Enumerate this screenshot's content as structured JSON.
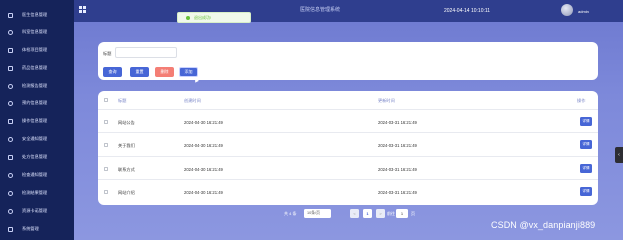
{
  "sidebar": {
    "items": [
      {
        "label": "医生信息管理",
        "icon": "document-icon"
      },
      {
        "label": "科室信息管理",
        "icon": "circle-check-icon"
      },
      {
        "label": "体检项目管理",
        "icon": "document-icon"
      },
      {
        "label": "药品信息管理",
        "icon": "document-icon"
      },
      {
        "label": "检测报告管理",
        "icon": "chat-icon"
      },
      {
        "label": "预约信息管理",
        "icon": "circle-check-icon"
      },
      {
        "label": "操作信息管理",
        "icon": "document-icon"
      },
      {
        "label": "安全通知管理",
        "icon": "circle-check-icon"
      },
      {
        "label": "处方信息管理",
        "icon": "document-icon"
      },
      {
        "label": "检查通知管理",
        "icon": "chat-icon"
      },
      {
        "label": "检测结果管理",
        "icon": "circle-check-icon"
      },
      {
        "label": "资源卡诺管理",
        "icon": "circle-check-icon"
      },
      {
        "label": "系统管理",
        "icon": "document-icon"
      }
    ]
  },
  "topbar": {
    "title": "医院信息管理系统",
    "datetime": "2024-04-14 10:10:11",
    "user": "admin"
  },
  "toast": {
    "text": "退出成功!"
  },
  "search": {
    "label": "标题",
    "placeholder": "",
    "buttons": {
      "query": "查询",
      "reset": "重置",
      "delete": "删除",
      "add": "添加"
    }
  },
  "table": {
    "columns": {
      "title": "标题",
      "created": "创建时间",
      "updated": "更新时间",
      "operation": "操作"
    },
    "rows": [
      {
        "title": "网站公告",
        "created": "2024-04-30 16:21:49",
        "updated": "2024-03-31 16:21:49",
        "action": "详情"
      },
      {
        "title": "关于我们",
        "created": "2024-04-30 16:21:49",
        "updated": "2024-03-31 16:21:49",
        "action": "详情"
      },
      {
        "title": "联系方式",
        "created": "2024-04-30 16:21:49",
        "updated": "2024-03-31 16:21:49",
        "action": "详情"
      },
      {
        "title": "网站介绍",
        "created": "2024-04-30 16:21:49",
        "updated": "2024-03-31 16:21:49",
        "action": "详情"
      }
    ]
  },
  "pagination": {
    "total": "共 4 条",
    "page_size": "10条/页",
    "prev": "<",
    "current": "1",
    "next": ">",
    "goto_label": "前往",
    "goto_value": "1",
    "goto_suffix": "页"
  },
  "side_handle": {
    "glyph": "‹"
  },
  "watermark": "CSDN @vx_danpianji889",
  "colors": {
    "sidebar_bg": "#15235a",
    "topbar_bg": "#2f3e8e",
    "content_bg": "#7d89da",
    "primary_button": "#4766d6",
    "delete_button": "#f47e75",
    "toast_success": "#67c23a"
  }
}
